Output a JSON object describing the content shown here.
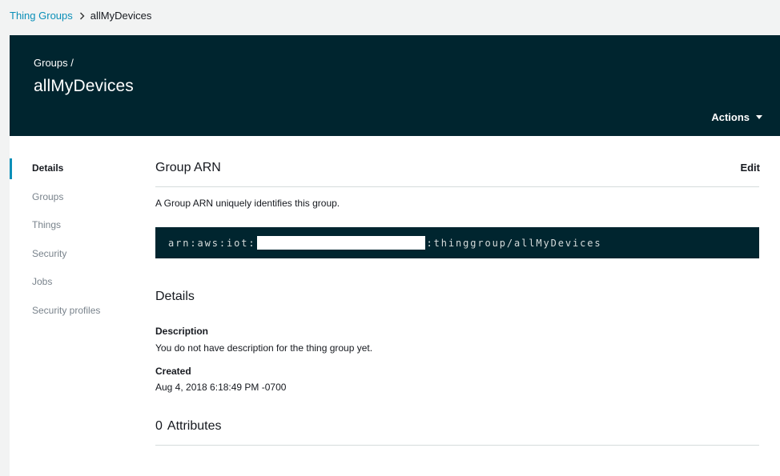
{
  "breadcrumb": {
    "parent": "Thing Groups",
    "current": "allMyDevices"
  },
  "header": {
    "sub": "Groups /",
    "title": "allMyDevices",
    "actions_label": "Actions"
  },
  "sidenav": {
    "items": [
      {
        "label": "Details",
        "active": true
      },
      {
        "label": "Groups"
      },
      {
        "label": "Things"
      },
      {
        "label": "Security"
      },
      {
        "label": "Jobs"
      },
      {
        "label": "Security profiles"
      }
    ]
  },
  "arn": {
    "title": "Group ARN",
    "edit_label": "Edit",
    "description": "A Group ARN uniquely identifies this group.",
    "prefix": "arn:aws:iot:",
    "suffix": ":thinggroup/allMyDevices"
  },
  "details": {
    "title": "Details",
    "description_label": "Description",
    "description_value": "You do not have description for the thing group yet.",
    "created_label": "Created",
    "created_value": "Aug 4, 2018 6:18:49 PM -0700"
  },
  "attributes": {
    "count": "0",
    "label": "Attributes"
  },
  "colors": {
    "header_bg": "#00252f",
    "link": "#0a8fb8",
    "active_indicator": "#0a8fb8",
    "page_bg": "#f2f3f3"
  }
}
